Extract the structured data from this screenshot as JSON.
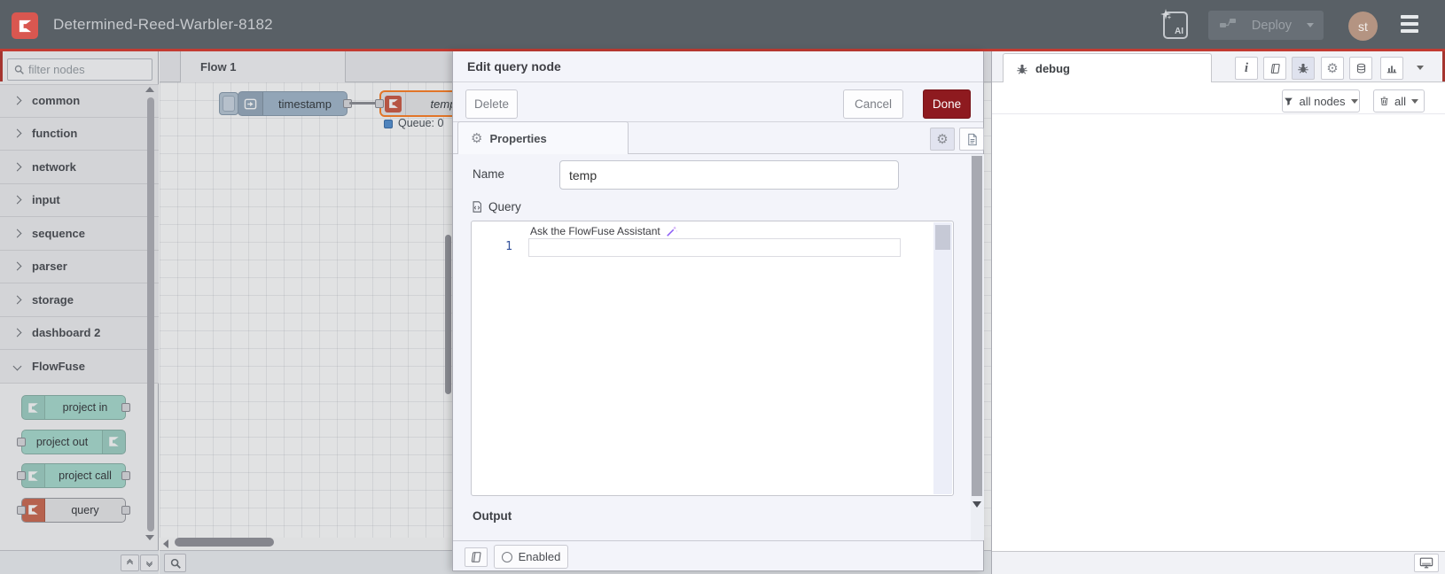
{
  "header": {
    "title": "Determined-Reed-Warbler-8182",
    "ai_label": "AI",
    "deploy_label": "Deploy",
    "avatar_initials": "st"
  },
  "palette": {
    "filter_placeholder": "filter nodes",
    "categories": [
      {
        "label": "common"
      },
      {
        "label": "function"
      },
      {
        "label": "network"
      },
      {
        "label": "input"
      },
      {
        "label": "sequence"
      },
      {
        "label": "parser"
      },
      {
        "label": "storage"
      },
      {
        "label": "dashboard 2"
      },
      {
        "label": "FlowFuse"
      }
    ],
    "flowfuse_nodes": [
      {
        "label": "project in"
      },
      {
        "label": "project out"
      },
      {
        "label": "project call"
      },
      {
        "label": "query"
      }
    ]
  },
  "canvas": {
    "tab_label": "Flow 1",
    "inject_label": "timestamp",
    "temp_label": "temp",
    "temp_status": "Queue: 0"
  },
  "dialog": {
    "title": "Edit query node",
    "delete_label": "Delete",
    "cancel_label": "Cancel",
    "done_label": "Done",
    "properties_tab": "Properties",
    "name_label": "Name",
    "name_value": "temp",
    "query_label": "Query",
    "line_number": "1",
    "assistant_placeholder": "Ask the FlowFuse Assistant",
    "output_label": "Output",
    "enabled_label": "Enabled"
  },
  "debug": {
    "tab_label": "debug",
    "filter_label": "all nodes",
    "clear_label": "all"
  },
  "colors": {
    "header_bg": "#596066",
    "brand_red": "#d95750",
    "header_accent_border": "#c23b32",
    "done_button_red": "#8e1a1f",
    "node_teal": "#a9ddd0",
    "inject_node_blue": "#a4b9cc",
    "selected_node_orange": "#ff8126",
    "status_dot_blue": "#5591d2",
    "query_icon_red": "#cd6a52"
  }
}
